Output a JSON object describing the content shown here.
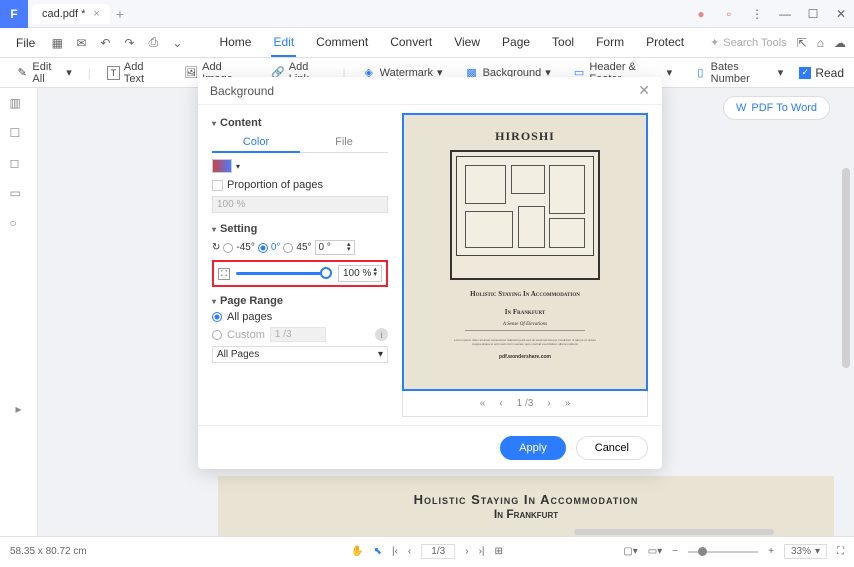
{
  "titlebar": {
    "filename": "cad.pdf *"
  },
  "menu": {
    "file": "File"
  },
  "main_tabs": [
    "Home",
    "Edit",
    "Comment",
    "Convert",
    "View",
    "Page",
    "Tool",
    "Form",
    "Protect"
  ],
  "active_tab": "Edit",
  "search_placeholder": "Search Tools",
  "toolbar": {
    "edit_all": "Edit All",
    "add_text": "Add Text",
    "add_image": "Add Image",
    "add_link": "Add Link",
    "watermark": "Watermark",
    "background": "Background",
    "header_footer": "Header & Footer",
    "bates": "Bates Number",
    "read": "Read"
  },
  "pdf_to_word": "PDF To Word",
  "dialog": {
    "title": "Background",
    "content": "Content",
    "color_tab": "Color",
    "file_tab": "File",
    "proportion": "Proportion of pages",
    "prop_value": "100 %",
    "setting": "Setting",
    "neg45": "-45°",
    "zero": "0°",
    "pos45": "45°",
    "angle_value": "0 °",
    "scale_value": "100 %",
    "page_range": "Page Range",
    "all_pages": "All pages",
    "custom": "Custom",
    "custom_value": "1 /3",
    "all_pages_select": "All Pages",
    "apply": "Apply",
    "cancel": "Cancel"
  },
  "preview": {
    "title": "HIROSHI",
    "subtitle1": "Holistic Staying In Accommodation",
    "subtitle2": "In Frankfurt",
    "tagline": "A Sense Of Elevations",
    "brand": "pdf.wondershare.com",
    "nav": "1 /3"
  },
  "doc_visible": {
    "line1": "Holistic Staying In Accommodation",
    "line2": "In Frankfurt"
  },
  "status": {
    "dims": "58.35 x 80.72 cm",
    "page": "1/3",
    "zoom": "33%"
  }
}
